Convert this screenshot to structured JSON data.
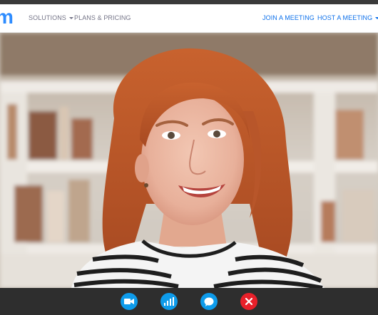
{
  "nav": {
    "logo_text": "m",
    "solutions_label": "SOLUTIONS",
    "pricing_label": "PLANS & PRICING",
    "join_label": "JOIN A MEETING",
    "host_label": "HOST A MEETING"
  },
  "toolbar": {
    "buttons": [
      {
        "icon": "video-camera-icon",
        "color": "#0e9bea"
      },
      {
        "icon": "signal-bars-icon",
        "color": "#0e9bea"
      },
      {
        "icon": "chat-bubble-icon",
        "color": "#0e9bea"
      },
      {
        "icon": "close-icon",
        "color": "#e8202a"
      }
    ]
  },
  "colors": {
    "brand": "#2d8cff",
    "link_blue": "#0e71eb",
    "hangup_red": "#e8202a"
  }
}
